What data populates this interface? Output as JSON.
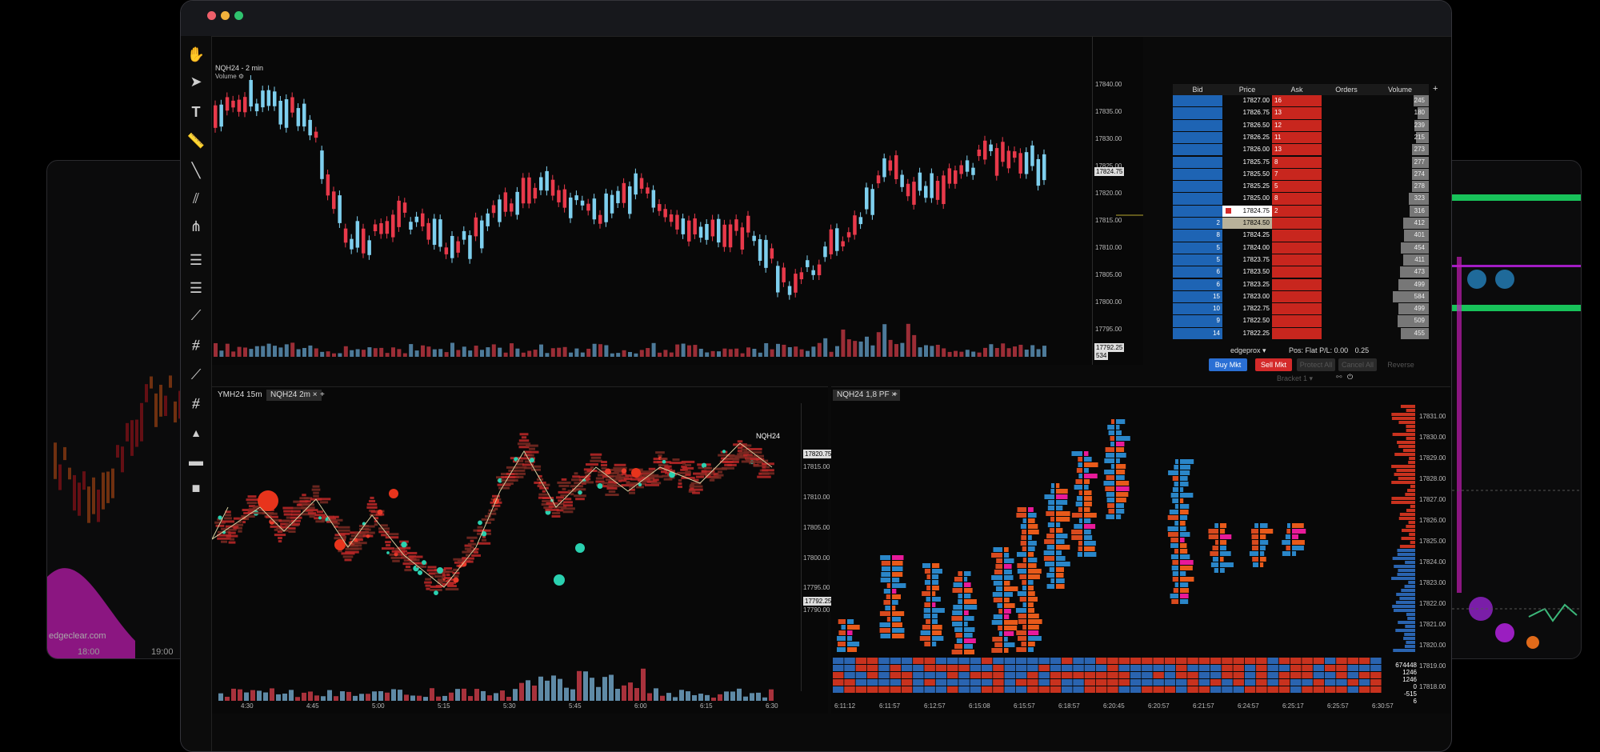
{
  "left_card": {
    "brand": "edgeclear.com",
    "times": [
      "18:00",
      "19:00"
    ]
  },
  "top_chart": {
    "title": "NQH24 - 2 min",
    "volume_label": "Volume",
    "y_ticks": [
      "17840.00",
      "17835.00",
      "17830.00",
      "17825.00",
      "17820.00",
      "17815.00",
      "17810.00",
      "17805.00",
      "17800.00",
      "17795.00"
    ],
    "price_tags": [
      "17824.75",
      "17792.25",
      "534"
    ]
  },
  "dom": {
    "headers": [
      "Bid",
      "Price",
      "Ask",
      "Orders",
      "Volume"
    ],
    "add_icon": "+",
    "rows": [
      {
        "bid": "",
        "price": "17827.00",
        "ask": "16",
        "vol": "245"
      },
      {
        "bid": "",
        "price": "17826.75",
        "ask": "13",
        "vol": "180"
      },
      {
        "bid": "",
        "price": "17826.50",
        "ask": "12",
        "vol": "239"
      },
      {
        "bid": "",
        "price": "17826.25",
        "ask": "11",
        "vol": "215"
      },
      {
        "bid": "",
        "price": "17826.00",
        "ask": "13",
        "vol": "273"
      },
      {
        "bid": "",
        "price": "17825.75",
        "ask": "8",
        "vol": "277"
      },
      {
        "bid": "",
        "price": "17825.50",
        "ask": "7",
        "vol": "274"
      },
      {
        "bid": "",
        "price": "17825.25",
        "ask": "5",
        "vol": "278"
      },
      {
        "bid": "",
        "price": "17825.00",
        "ask": "8",
        "vol": "323"
      },
      {
        "bid": "",
        "price": "17824.75",
        "ask": "2",
        "vol": "316"
      },
      {
        "bid": "2",
        "price": "17824.50",
        "ask": "",
        "vol": "412"
      },
      {
        "bid": "8",
        "price": "17824.25",
        "ask": "",
        "vol": "401"
      },
      {
        "bid": "5",
        "price": "17824.00",
        "ask": "",
        "vol": "454"
      },
      {
        "bid": "5",
        "price": "17823.75",
        "ask": "",
        "vol": "411"
      },
      {
        "bid": "6",
        "price": "17823.50",
        "ask": "",
        "vol": "473"
      },
      {
        "bid": "6",
        "price": "17823.25",
        "ask": "",
        "vol": "499"
      },
      {
        "bid": "15",
        "price": "17823.00",
        "ask": "",
        "vol": "584"
      },
      {
        "bid": "10",
        "price": "17822.75",
        "ask": "",
        "vol": "499"
      },
      {
        "bid": "9",
        "price": "17822.50",
        "ask": "",
        "vol": "509"
      },
      {
        "bid": "14",
        "price": "17822.25",
        "ask": "",
        "vol": "455"
      }
    ],
    "account": "edgeprox",
    "pos_label": "Pos:",
    "pos_value": "Flat",
    "pl_label": "P/L:",
    "pl_value": "0.00",
    "qty": "0.25",
    "buy_mkt": "Buy Mkt",
    "sell_mkt": "Sell Mkt",
    "protect_all": "Protect All",
    "cancel_all": "Cancel All",
    "reverse": "Reverse",
    "bracket": "Bracket 1"
  },
  "bottom_left": {
    "tabs": [
      "YMH24 15m",
      "NQH24 2m"
    ],
    "close": "×",
    "add": "+",
    "series_label": "NQH24",
    "y_ticks": [
      "17820.75",
      "17815.00",
      "17810.00",
      "17805.00",
      "17800.00",
      "17795.00",
      "17792.25",
      "17790.00"
    ],
    "x_ticks": [
      "4:30",
      "4:45",
      "5:00",
      "5:15",
      "5:30",
      "5:45",
      "6:00",
      "6:15",
      "6:30"
    ]
  },
  "bottom_right": {
    "tab": "NQH24 1,8 PF",
    "close": "×",
    "add": "+",
    "y_ticks": [
      "17831.00",
      "17830.00",
      "17829.00",
      "17828.00",
      "17827.00",
      "17826.00",
      "17825.00",
      "17824.00",
      "17823.00",
      "17822.00",
      "17821.00",
      "17820.00",
      "17819.00",
      "17818.00"
    ],
    "x_ticks": [
      "6:11:12",
      "6:11:57",
      "6:12:57",
      "6:15:08",
      "6:15:57",
      "6:18:57",
      "6:20:45",
      "6:20:57",
      "6:21:57",
      "6:24:57",
      "6:25:17",
      "6:25:57",
      "6:30:57"
    ],
    "stats": [
      "674448",
      "1246",
      "1246",
      "0",
      "-515",
      "6"
    ]
  },
  "colors": {
    "up": "#7ecfee",
    "down": "#e8394a",
    "bid": "#1e64b4",
    "ask": "#c8261e",
    "accent": "#2a6fd4"
  }
}
